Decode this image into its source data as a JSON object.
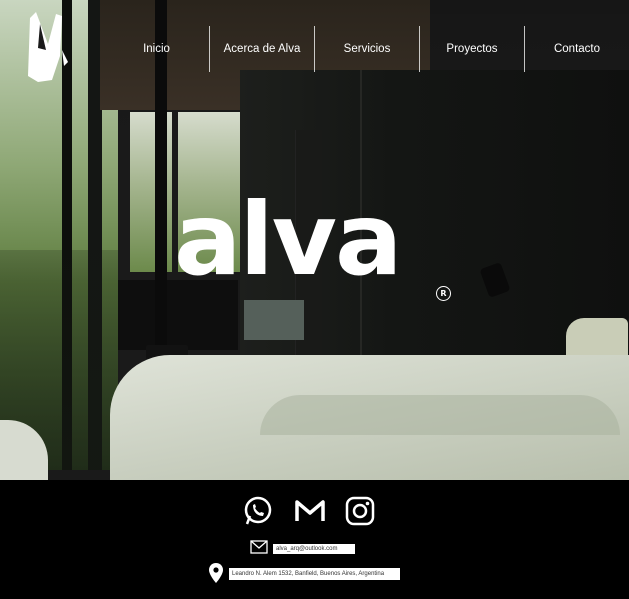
{
  "nav": {
    "items": [
      {
        "label": "Inicio"
      },
      {
        "label": "Acerca de Alva"
      },
      {
        "label": "Servicios"
      },
      {
        "label": "Proyectos"
      },
      {
        "label": "Contacto"
      }
    ]
  },
  "hero": {
    "brand_text": "alva",
    "registered_mark": "R",
    "logo_icon": "brand-logo-mark"
  },
  "footer": {
    "social": [
      {
        "icon": "whatsapp-icon"
      },
      {
        "icon": "gmail-icon"
      },
      {
        "icon": "instagram-icon"
      }
    ],
    "email": "alva_arq@outlook.com",
    "address": "Leandro N. Alem 1532, Banfield, Buenos Aires, Argentina"
  },
  "colors": {
    "background": "#000000",
    "text": "#ffffff"
  }
}
